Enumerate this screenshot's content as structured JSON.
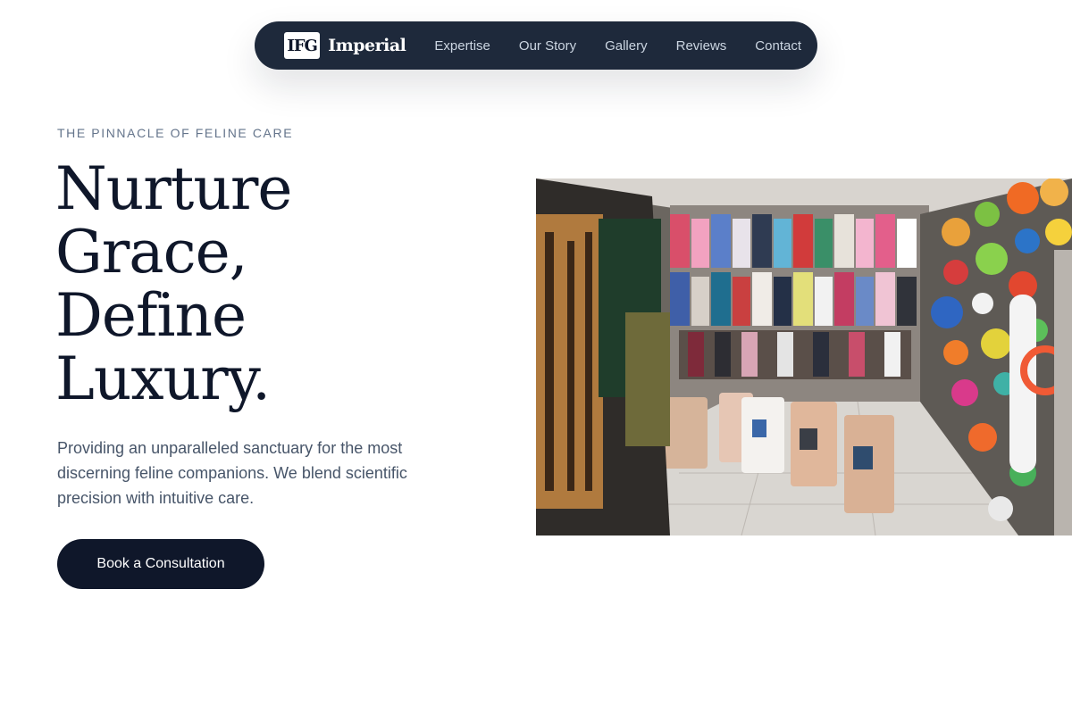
{
  "nav": {
    "logo_mark": "IFG",
    "brand": "Imperial",
    "links": [
      "Expertise",
      "Our Story",
      "Gallery",
      "Reviews",
      "Contact"
    ]
  },
  "hero": {
    "eyebrow": "THE PINNACLE OF FELINE CARE",
    "headline_lines": [
      "Nurture",
      "Grace,",
      "Define",
      "Luxury."
    ],
    "lead": "Providing an unparalleled sanctuary for the most discerning feline companions. We blend scientific precision with intuitive care.",
    "cta_label": "Book a Consultation"
  },
  "colors": {
    "nav_bg": "#1e293b",
    "primary": "#0f172a",
    "muted": "#64748b",
    "body_text": "#475569"
  }
}
